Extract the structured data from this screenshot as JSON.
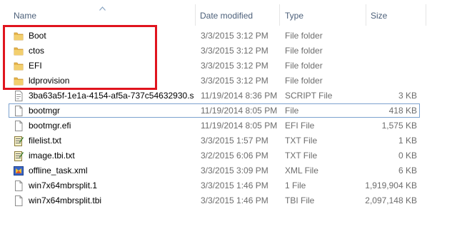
{
  "columns": {
    "name": "Name",
    "date": "Date modified",
    "type": "Type",
    "size": "Size"
  },
  "files": [
    {
      "name": "Boot",
      "date": "3/3/2015 3:12 PM",
      "type": "File folder",
      "size": "",
      "icon": "folder-icon"
    },
    {
      "name": "ctos",
      "date": "3/3/2015 3:12 PM",
      "type": "File folder",
      "size": "",
      "icon": "folder-icon"
    },
    {
      "name": "EFI",
      "date": "3/3/2015 3:12 PM",
      "type": "File folder",
      "size": "",
      "icon": "folder-icon"
    },
    {
      "name": "ldprovision",
      "date": "3/3/2015 3:12 PM",
      "type": "File folder",
      "size": "",
      "icon": "folder-icon"
    },
    {
      "name": "3ba63a5f-1e1a-4154-af5a-737c54632930.s...",
      "date": "11/19/2014 8:36 PM",
      "type": "SCRIPT File",
      "size": "3 KB",
      "icon": "script-file-icon"
    },
    {
      "name": "bootmgr",
      "date": "11/19/2014 8:05 PM",
      "type": "File",
      "size": "418 KB",
      "icon": "file-icon"
    },
    {
      "name": "bootmgr.efi",
      "date": "11/19/2014 8:05 PM",
      "type": "EFI File",
      "size": "1,575 KB",
      "icon": "file-icon"
    },
    {
      "name": "filelist.txt",
      "date": "3/3/2015 1:57 PM",
      "type": "TXT File",
      "size": "1 KB",
      "icon": "text-file-icon"
    },
    {
      "name": "image.tbi.txt",
      "date": "3/2/2015 6:06 PM",
      "type": "TXT File",
      "size": "0 KB",
      "icon": "text-file-icon"
    },
    {
      "name": "offline_task.xml",
      "date": "3/3/2015 3:09 PM",
      "type": "XML File",
      "size": "6 KB",
      "icon": "xml-file-icon"
    },
    {
      "name": "win7x64mbrsplit.1",
      "date": "3/3/2015 1:46 PM",
      "type": "1 File",
      "size": "1,919,904 KB",
      "icon": "file-icon"
    },
    {
      "name": "win7x64mbrsplit.tbi",
      "date": "3/3/2015 1:46 PM",
      "type": "TBI File",
      "size": "2,097,148 KB",
      "icon": "file-icon"
    }
  ],
  "selected_index": 5,
  "highlight_color": "#e0141e",
  "folder_color": "#e8b64c"
}
